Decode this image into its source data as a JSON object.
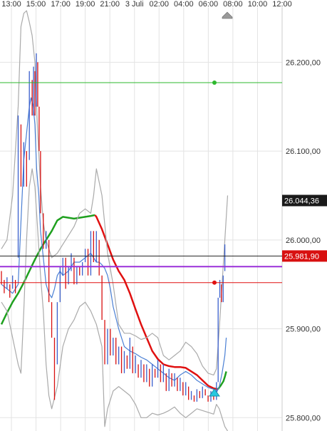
{
  "chart_data": {
    "type": "line",
    "title": "",
    "xlabel": "",
    "ylabel": "",
    "x_ticks": [
      "13:00",
      "15:00",
      "17:00",
      "19:00",
      "21:00",
      "3 Juli",
      "02:00",
      "04:00",
      "06:00",
      "08:00",
      "10:00",
      "12:00"
    ],
    "y_ticks": [
      "26.200,00",
      "26.100,00",
      "26.000,00",
      "25.900,00",
      "25.800,00"
    ],
    "y_tick_values": [
      26200,
      26100,
      26000,
      25900,
      25800
    ],
    "ylim": [
      25785,
      26262
    ],
    "grid": true,
    "price_tags": [
      {
        "label": "26.044,36",
        "value": 26044.36,
        "style": "dark"
      },
      {
        "label": "25.981,90",
        "value": 25981.9,
        "style": "red"
      }
    ],
    "levels": [
      {
        "value": 26177,
        "color": "#2db82d",
        "marker": true
      },
      {
        "value": 25981.9,
        "color": "#222222",
        "marker": false
      },
      {
        "value": 25970,
        "color": "#9b30d9",
        "marker": false
      },
      {
        "value": 25952,
        "color": "#e01010",
        "marker": true
      }
    ],
    "series": [
      {
        "color": "#1fa01f",
        "x": [
          0,
          2,
          4,
          6,
          8,
          10,
          12,
          14,
          16,
          18,
          20,
          22,
          24,
          26,
          28,
          30,
          32,
          33.5
        ],
        "y": [
          25905,
          25918,
          25930,
          25940,
          25952,
          25965,
          25978,
          25990,
          26000,
          26010,
          26022,
          26026,
          26025,
          26024,
          26025,
          26026,
          26027,
          26028
        ]
      },
      {
        "color": "#e01010",
        "x": [
          33.5,
          34,
          36,
          38,
          40,
          42,
          44,
          46,
          48,
          50,
          52,
          54,
          56,
          58,
          60,
          62,
          64,
          66,
          68,
          70,
          72,
          74,
          76,
          77.5
        ],
        "y": [
          26028,
          26026,
          26012,
          25995,
          25978,
          25965,
          25955,
          25940,
          25922,
          25905,
          25890,
          25875,
          25866,
          25860,
          25858,
          25857,
          25857,
          25856,
          25852,
          25848,
          25842,
          25836,
          25833,
          25832
        ]
      },
      {
        "color": "#1fa01f",
        "x": [
          77.5,
          78.5,
          79.5,
          80,
          80.5
        ],
        "y": [
          25832,
          25836,
          25841,
          25846,
          25852
        ]
      },
      {
        "color": "#4a7fd4",
        "x": [
          0,
          2,
          4,
          6,
          7,
          8,
          9,
          10,
          10.6,
          11.4,
          12,
          12.6,
          13.4,
          14,
          15,
          16,
          17,
          18,
          19,
          20,
          21,
          22,
          24,
          26,
          28,
          30,
          32,
          34,
          35,
          36,
          37,
          38,
          39,
          40,
          42,
          44,
          46,
          48,
          50,
          52,
          54,
          56,
          58,
          60,
          62,
          64,
          66,
          68,
          70,
          72,
          74,
          76,
          77,
          78,
          79,
          80,
          80.5
        ],
        "y": [
          25950,
          25945,
          25940,
          25950,
          26020,
          26090,
          26120,
          26150,
          26160,
          26150,
          26130,
          26080,
          26050,
          26010,
          25980,
          25950,
          25940,
          25935,
          25945,
          25960,
          25965,
          25960,
          25965,
          25975,
          25975,
          25980,
          25985,
          25975,
          25975,
          25972,
          25968,
          25960,
          25945,
          25925,
          25900,
          25880,
          25875,
          25872,
          25868,
          25865,
          25860,
          25855,
          25850,
          25845,
          25842,
          25848,
          25852,
          25848,
          25842,
          25838,
          25834,
          25832,
          25828,
          25835,
          25850,
          25870,
          25890
        ]
      },
      {
        "color": "#aaaaaa",
        "x": [
          0,
          2,
          4,
          6,
          7,
          8,
          9,
          10,
          11,
          12,
          13,
          14,
          15,
          16,
          17,
          18,
          20,
          22,
          24,
          26,
          28,
          30,
          32,
          33,
          34,
          36,
          38,
          40,
          42,
          44,
          46,
          48,
          50,
          52,
          54,
          56,
          58,
          60,
          62,
          64,
          66,
          68,
          70,
          72,
          74,
          76,
          77,
          78,
          79,
          80,
          81
        ],
        "y": [
          25990,
          26000,
          26050,
          26150,
          26240,
          26255,
          26258,
          26245,
          26230,
          26200,
          26120,
          26060,
          26020,
          26000,
          25990,
          25980,
          25985,
          25995,
          26005,
          26015,
          26030,
          26035,
          26030,
          26050,
          26080,
          26050,
          25985,
          25950,
          25905,
          25895,
          25895,
          25892,
          25888,
          25890,
          25895,
          25890,
          25870,
          25865,
          25870,
          25875,
          25885,
          25880,
          25872,
          25858,
          25850,
          25848,
          25855,
          25900,
          25950,
          26000,
          26050
        ]
      },
      {
        "color": "#aaaaaa",
        "x": [
          0,
          2,
          4,
          6,
          7,
          8,
          9,
          10,
          11,
          12,
          13,
          14,
          15,
          16,
          17,
          18,
          20,
          22,
          24,
          26,
          28,
          30,
          32,
          34,
          36,
          37,
          38,
          40,
          42,
          44,
          46,
          48,
          50,
          52,
          54,
          56,
          58,
          60,
          62,
          64,
          66,
          68,
          70,
          72,
          74,
          76,
          77,
          78,
          79,
          80,
          81
        ],
        "y": [
          25930,
          25920,
          25890,
          25860,
          25850,
          25920,
          26000,
          26060,
          26080,
          26060,
          26010,
          25960,
          25920,
          25860,
          25825,
          25810,
          25835,
          25880,
          25900,
          25910,
          25925,
          25930,
          25920,
          25905,
          25880,
          25790,
          25810,
          25830,
          25835,
          25830,
          25825,
          25815,
          25800,
          25800,
          25805,
          25803,
          25805,
          25808,
          25812,
          25805,
          25800,
          25805,
          25810,
          25808,
          25806,
          25804,
          25815,
          25810,
          25800,
          25790,
          25785
        ]
      }
    ],
    "candles": [
      [
        0,
        25965,
        25950
      ],
      [
        1,
        25955,
        25940
      ],
      [
        2,
        25945,
        25958
      ],
      [
        3,
        25950,
        25935
      ],
      [
        4,
        25945,
        25960
      ],
      [
        5,
        25955,
        25940
      ],
      [
        6,
        25980,
        26140
      ],
      [
        7,
        26130,
        26060
      ],
      [
        8,
        26060,
        26110
      ],
      [
        9,
        26100,
        26060
      ],
      [
        10,
        26090,
        26190
      ],
      [
        11,
        26180,
        26140
      ],
      [
        11.5,
        26140,
        26195
      ],
      [
        12,
        26190,
        26140
      ],
      [
        12.5,
        26150,
        26210
      ],
      [
        13,
        26200,
        26150
      ],
      [
        13.5,
        26150,
        26100
      ],
      [
        14,
        26100,
        26030
      ],
      [
        15,
        26030,
        25990
      ],
      [
        16,
        25990,
        26010
      ],
      [
        17,
        26000,
        25930
      ],
      [
        18,
        25930,
        25890
      ],
      [
        19,
        25890,
        25820
      ],
      [
        20,
        25860,
        25930
      ],
      [
        21,
        25930,
        25970
      ],
      [
        22,
        25960,
        25980
      ],
      [
        23,
        25980,
        25945
      ],
      [
        24,
        25950,
        25970
      ],
      [
        25,
        25965,
        25985
      ],
      [
        26,
        25980,
        25950
      ],
      [
        27,
        25950,
        25970
      ],
      [
        28,
        25970,
        25960
      ],
      [
        29,
        25960,
        25975
      ],
      [
        30,
        25975,
        25990
      ],
      [
        31,
        25990,
        25960
      ],
      [
        32,
        25960,
        26010
      ],
      [
        33,
        26010,
        25975
      ],
      [
        34,
        25975,
        26010
      ],
      [
        35,
        26000,
        25960
      ],
      [
        36,
        25960,
        25910
      ],
      [
        37,
        25910,
        25860
      ],
      [
        38,
        25860,
        25900
      ],
      [
        39,
        25900,
        25870
      ],
      [
        40,
        25870,
        25890
      ],
      [
        41,
        25890,
        25860
      ],
      [
        42,
        25860,
        25880
      ],
      [
        43,
        25880,
        25850
      ],
      [
        44,
        25850,
        25875
      ],
      [
        45,
        25870,
        25855
      ],
      [
        46,
        25855,
        25890
      ],
      [
        47,
        25880,
        25850
      ],
      [
        48,
        25850,
        25870
      ],
      [
        49,
        25860,
        25845
      ],
      [
        50,
        25845,
        25865
      ],
      [
        51,
        25860,
        25840
      ],
      [
        52,
        25840,
        25860
      ],
      [
        53,
        25855,
        25835
      ],
      [
        54,
        25835,
        25860
      ],
      [
        55,
        25855,
        25845
      ],
      [
        56,
        25845,
        25865
      ],
      [
        57,
        25860,
        25840
      ],
      [
        58,
        25840,
        25860
      ],
      [
        59,
        25850,
        25830
      ],
      [
        60,
        25830,
        25855
      ],
      [
        61,
        25850,
        25835
      ],
      [
        62,
        25835,
        25850
      ],
      [
        63,
        25845,
        25830
      ],
      [
        64,
        25830,
        25845
      ],
      [
        65,
        25840,
        25825
      ],
      [
        66,
        25825,
        25840
      ],
      [
        67,
        25835,
        25820
      ],
      [
        68,
        25820,
        25830
      ],
      [
        69,
        25825,
        25818
      ],
      [
        70,
        25818,
        25832
      ],
      [
        71,
        25830,
        25822
      ],
      [
        72,
        25822,
        25835
      ],
      [
        73,
        25832,
        25825
      ],
      [
        74,
        25825,
        25818
      ],
      [
        75,
        25818,
        25830
      ],
      [
        76,
        25830,
        25820
      ],
      [
        77,
        25820,
        25840
      ],
      [
        77.6,
        25840,
        25935
      ],
      [
        78.2,
        25935,
        25955
      ],
      [
        78.8,
        25950,
        25930
      ],
      [
        79.4,
        25930,
        25960
      ],
      [
        80,
        25965,
        25995
      ]
    ],
    "candle_up_color": "#3a5fcd",
    "candle_down_color": "#d81010"
  }
}
